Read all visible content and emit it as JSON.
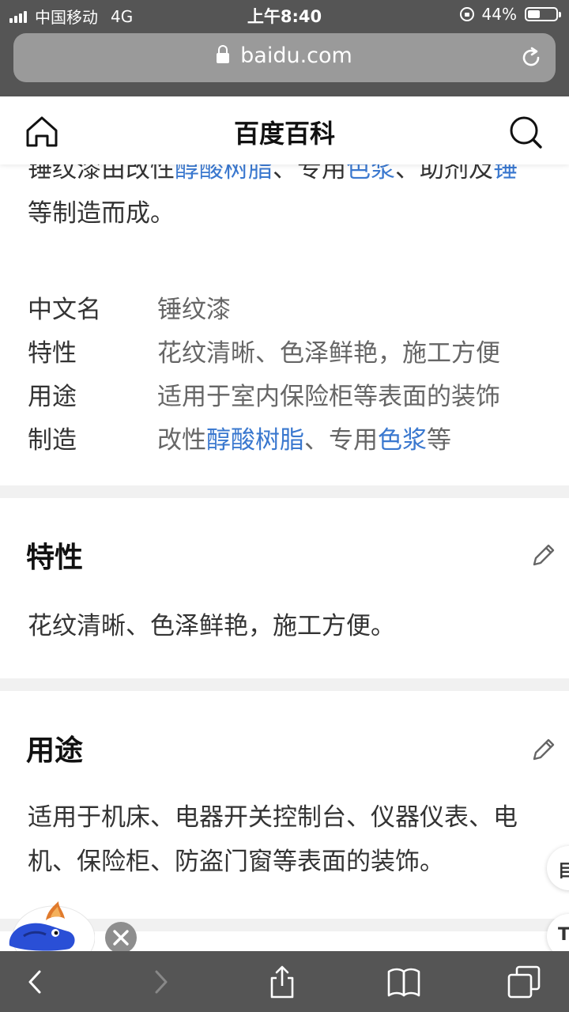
{
  "status_bar": {
    "carrier": "中国移动",
    "network": "4G",
    "time": "上午8:40",
    "battery_percent": "44%",
    "battery_level": 0.44
  },
  "browser": {
    "url": "baidu.com"
  },
  "site": {
    "title": "百度百科"
  },
  "intro": {
    "line1_parts": [
      {
        "text": "锤纹漆由改性",
        "link": false
      },
      {
        "text": "醇酸树脂",
        "link": true
      },
      {
        "text": "、专用",
        "link": false
      },
      {
        "text": "色浆",
        "link": true
      },
      {
        "text": "、助剂及",
        "link": false
      },
      {
        "text": "锤",
        "link": true
      }
    ],
    "line2": "等制造而成。"
  },
  "info_table": [
    {
      "key": "中文名",
      "value_parts": [
        {
          "text": "锤纹漆",
          "link": false
        }
      ]
    },
    {
      "key": "特性",
      "value_parts": [
        {
          "text": "花纹清晰、色泽鲜艳，施工方便",
          "link": false
        }
      ]
    },
    {
      "key": "用途",
      "value_parts": [
        {
          "text": "适用于室内保险柜等表面的装饰",
          "link": false
        }
      ]
    },
    {
      "key": "制造",
      "value_parts": [
        {
          "text": "改性",
          "link": false
        },
        {
          "text": "醇酸树脂",
          "link": true
        },
        {
          "text": "、专用",
          "link": false
        },
        {
          "text": "色浆",
          "link": true
        },
        {
          "text": "等",
          "link": false
        }
      ]
    }
  ],
  "sections": [
    {
      "title": "特性",
      "lines": [
        "花纹清晰、色泽鲜艳，施工方便。"
      ]
    },
    {
      "title": "用途",
      "lines": [
        "适用于机床、电器开关控制台、仪器仪表、电",
        "机、保险柜、防盗门窗等表面的装饰。"
      ]
    }
  ],
  "float_buttons": [
    "目",
    "T"
  ],
  "colors": {
    "link": "#3a78cf",
    "chrome": "#555555",
    "divider": "#f1f1f1"
  }
}
